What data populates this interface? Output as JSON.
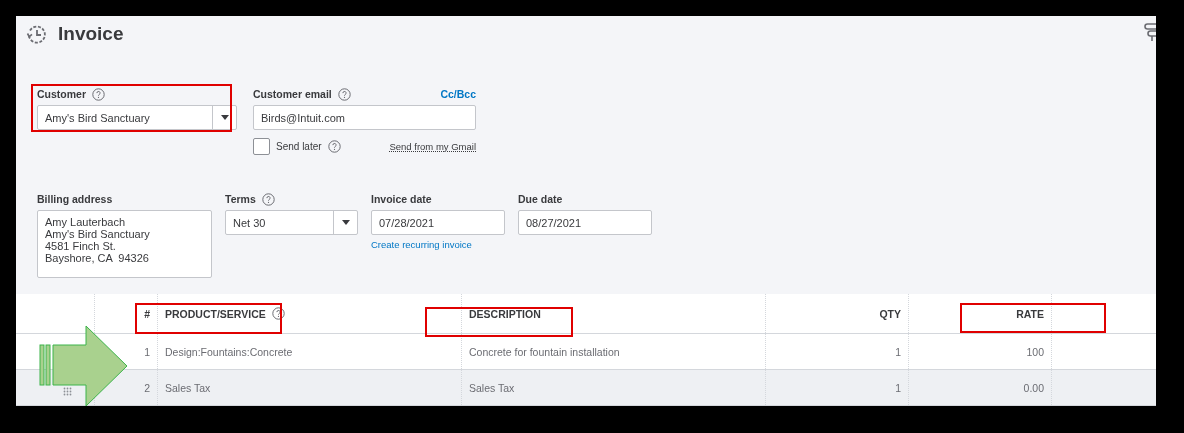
{
  "page": {
    "title": "Invoice"
  },
  "customer": {
    "label": "Customer",
    "value": "Amy's Bird Sanctuary"
  },
  "customer_email": {
    "label": "Customer email",
    "value": "Birds@Intuit.com",
    "cc_bcc_link": "Cc/Bcc",
    "send_later": {
      "label": "Send later",
      "checked": false
    },
    "gmail_link": "Send from my Gmail"
  },
  "billing_address": {
    "label": "Billing address",
    "lines": [
      "Amy Lauterbach",
      "Amy's Bird Sanctuary",
      "4581 Finch St.",
      "Bayshore, CA  94326"
    ]
  },
  "terms": {
    "label": "Terms",
    "value": "Net 30"
  },
  "invoice_date": {
    "label": "Invoice date",
    "value": "07/28/2021",
    "recurring_link": "Create recurring invoice"
  },
  "due_date": {
    "label": "Due date",
    "value": "08/27/2021"
  },
  "table": {
    "columns": [
      {
        "label": "#",
        "help": false
      },
      {
        "label": "PRODUCT/SERVICE",
        "help": true
      },
      {
        "label": "DESCRIPTION",
        "help": false
      },
      {
        "label": "QTY",
        "help": false
      },
      {
        "label": "RATE",
        "help": false
      }
    ],
    "rows": [
      {
        "number": "1",
        "product": "Design:Fountains:Concrete",
        "description": "Concrete for fountain installation",
        "qty": "1",
        "rate": "100",
        "hovered": false
      },
      {
        "number": "2",
        "product": "Sales Tax",
        "description": "Sales Tax",
        "qty": "1",
        "rate": "0.00",
        "hovered": true
      }
    ]
  }
}
